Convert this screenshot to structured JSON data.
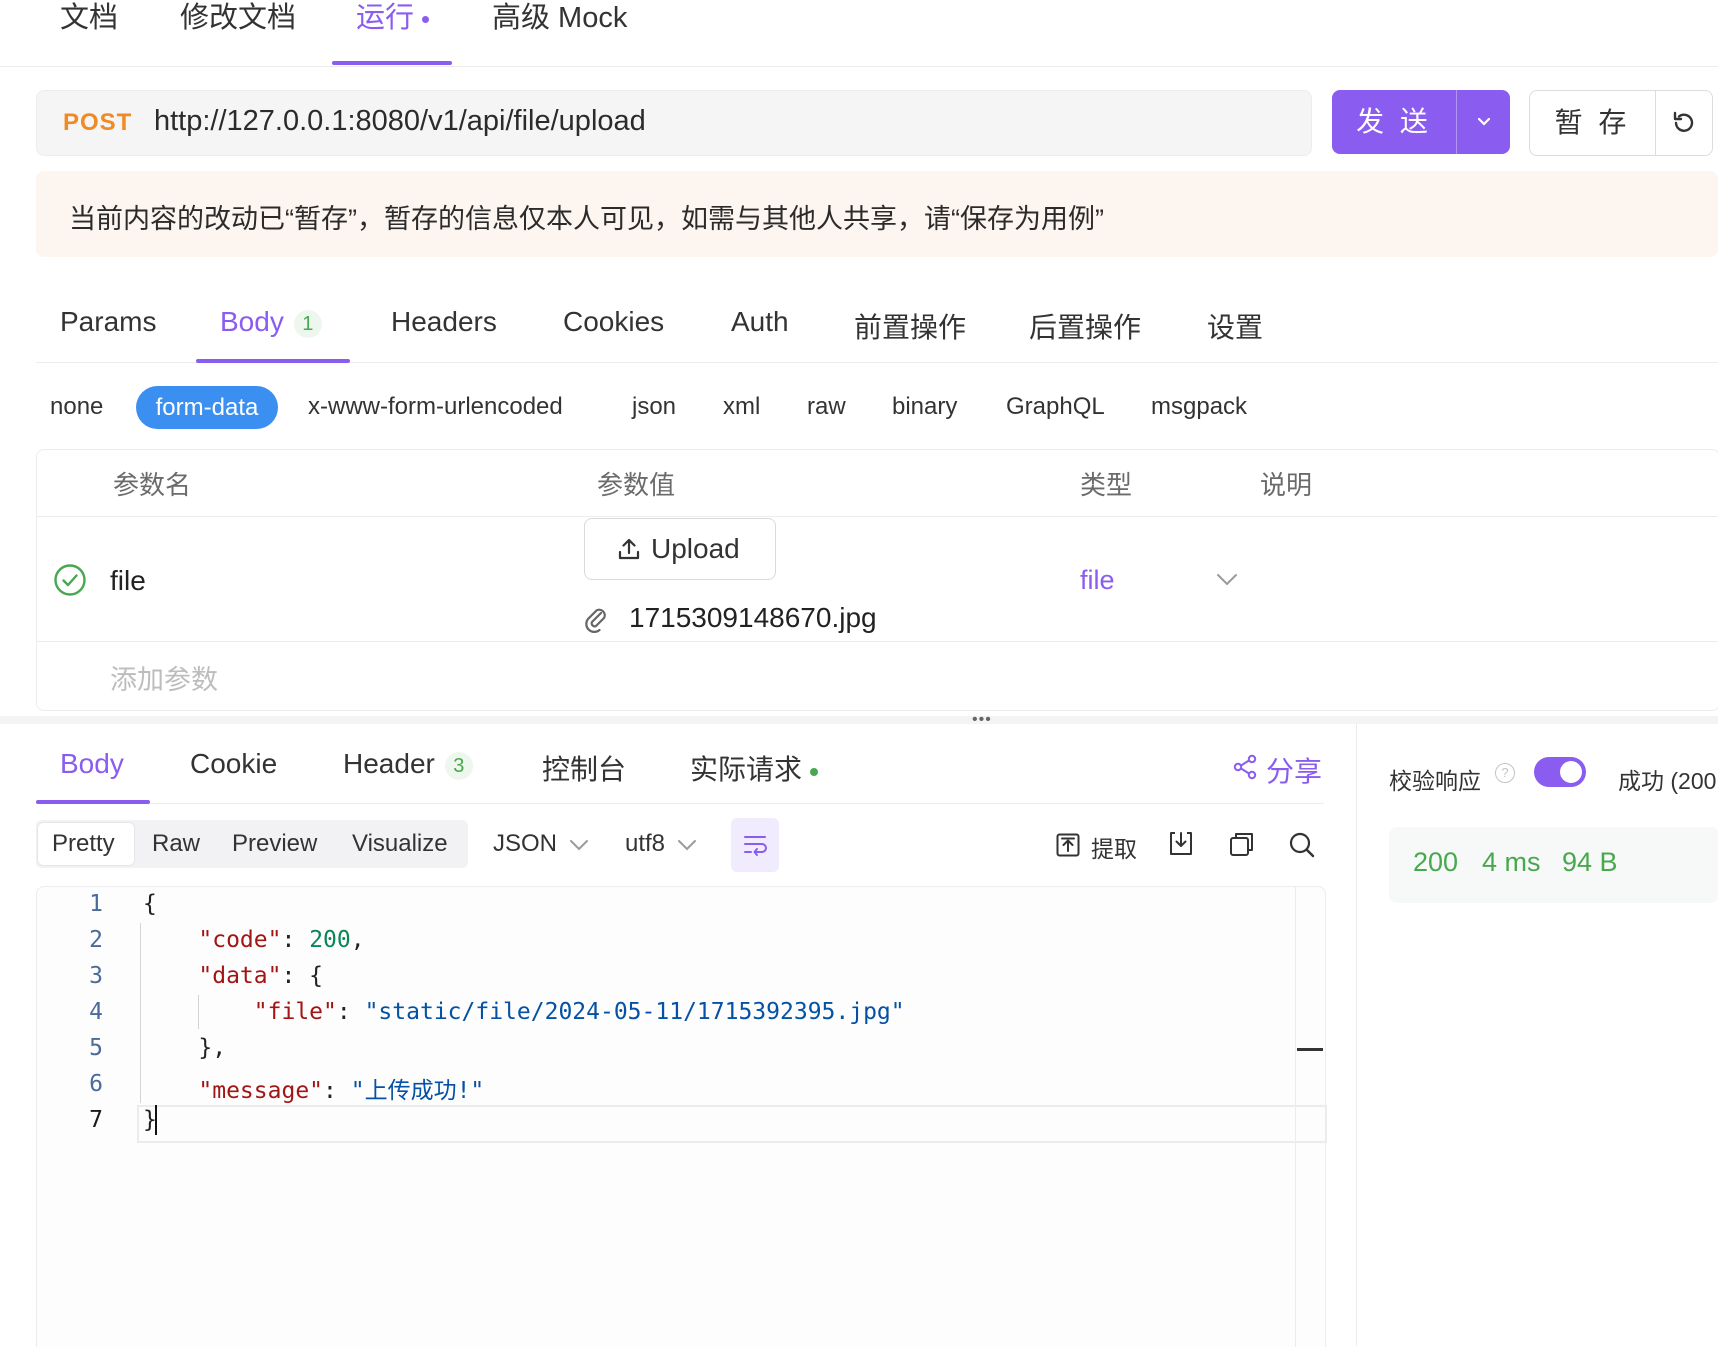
{
  "top_tabs": [
    "文档",
    "修改文档",
    "运行",
    "高级 Mock"
  ],
  "request": {
    "method": "POST",
    "url": "http://127.0.0.1:8080/v1/api/file/upload",
    "send_label": "发 送",
    "stash_label": "暂 存"
  },
  "notice": "当前内容的改动已“暂存”，暂存的信息仅本人可见，如需与其他人共享，请“保存为用例”",
  "request_tabs": {
    "params": "Params",
    "body": "Body",
    "body_count": "1",
    "headers": "Headers",
    "cookies": "Cookies",
    "auth": "Auth",
    "pre": "前置操作",
    "post": "后置操作",
    "settings": "设置"
  },
  "body_types": [
    "none",
    "form-data",
    "x-www-form-urlencoded",
    "json",
    "xml",
    "raw",
    "binary",
    "GraphQL",
    "msgpack"
  ],
  "params_table": {
    "headers": [
      "参数名",
      "参数值",
      "类型",
      "说明"
    ],
    "rows": [
      {
        "name": "file",
        "upload_label": "Upload",
        "file_name": "1715309148670.jpg",
        "type": "file",
        "enabled": true
      }
    ],
    "add_placeholder": "添加参数"
  },
  "response_tabs": {
    "body": "Body",
    "cookie": "Cookie",
    "header": "Header",
    "header_count": "3",
    "console": "控制台",
    "actual": "实际请求",
    "share": "分享"
  },
  "view_modes": [
    "Pretty",
    "Raw",
    "Preview",
    "Visualize"
  ],
  "format": "JSON",
  "encoding": "utf8",
  "toolbar": {
    "extract": "提取"
  },
  "code_lines": [
    "1",
    "2",
    "3",
    "4",
    "5",
    "6",
    "7"
  ],
  "response_json": {
    "code_key": "\"code\"",
    "code_val": "200",
    "data_key": "\"data\"",
    "file_key": "\"file\"",
    "file_val": "\"static/file/2024-05-11/1715392395.jpg\"",
    "message_key": "\"message\"",
    "message_val": "\"上传成功!\""
  },
  "validation": {
    "label": "校验响应",
    "toggle_on": true,
    "result": "成功 (200"
  },
  "status": {
    "code": "200",
    "time": "4 ms",
    "size": "94 B"
  },
  "colors": {
    "accent": "#8a5cf0",
    "method": "#f08a24",
    "pill": "#3b8ff0",
    "success": "#48a84f"
  }
}
